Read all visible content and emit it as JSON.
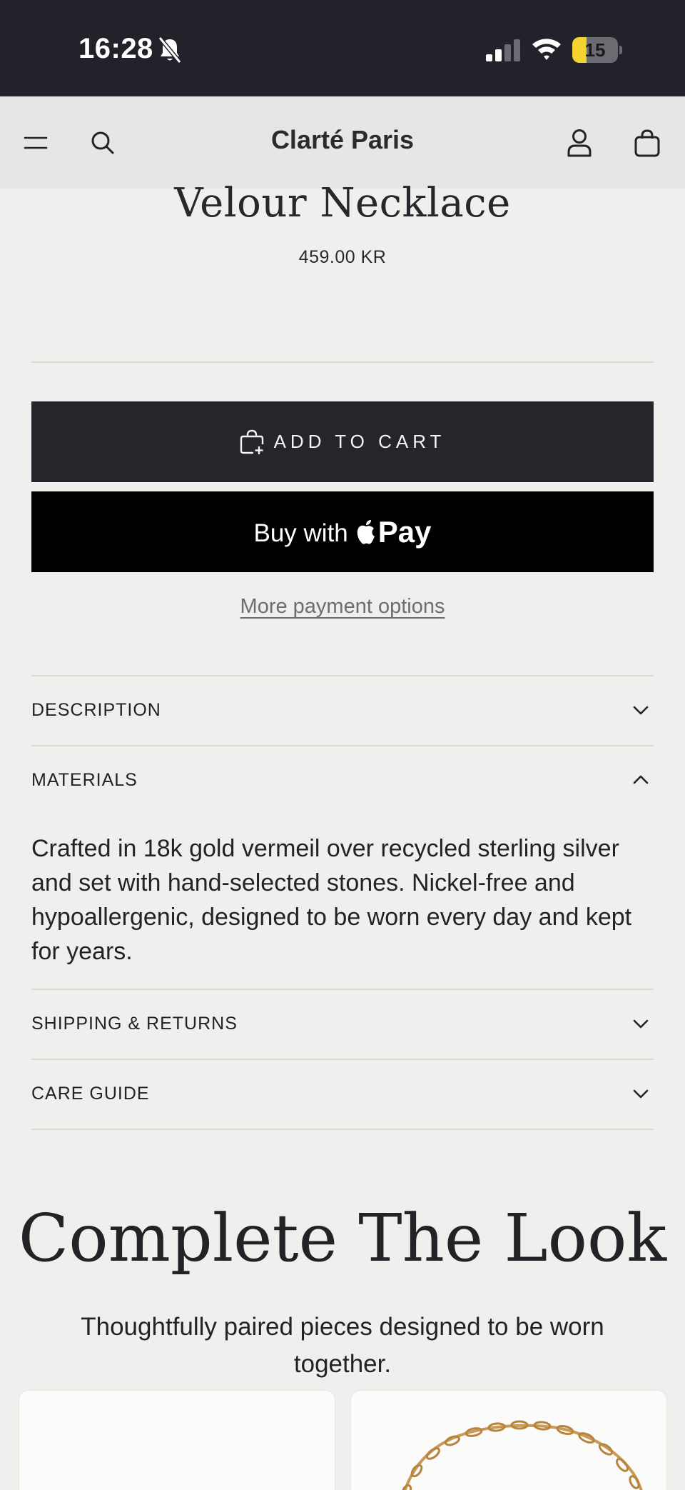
{
  "status_bar": {
    "time": "16:28",
    "battery": "15",
    "battery_level": 0.15
  },
  "header": {
    "brand": "Clarté Paris"
  },
  "product": {
    "title": "Velour Necklace",
    "price": "459.00 KR"
  },
  "actions": {
    "add_to_cart": "ADD TO CART",
    "buy_with": "Buy with",
    "pay": "Pay",
    "more_payment": "More payment options"
  },
  "accordion": {
    "description": "DESCRIPTION",
    "materials": "MATERIALS",
    "materials_body": "Crafted in 18k gold vermeil over recycled sterling silver and set with hand-selected stones. Nickel-free and hypoallergenic, designed to be worn every day and kept for years.",
    "shipping": "SHIPPING & RETURNS",
    "care": "CARE GUIDE"
  },
  "complete_look": {
    "title": "Complete The Look",
    "subtitle": "Thoughtfully paired pieces designed to be worn together."
  },
  "colors": {
    "background": "#f0efed",
    "header_bg": "#e6e6e4",
    "status_bar_bg": "#22232a",
    "primary_button": "#25262b",
    "apple_pay_button": "#000000",
    "battery_yellow": "#f4d22f",
    "chain_gold": "#c99a55"
  },
  "icons": {
    "status": [
      "bell-slash-icon",
      "signal-icon",
      "wifi-icon",
      "battery-icon"
    ],
    "header": [
      "menu-icon",
      "search-icon",
      "account-icon",
      "bag-icon"
    ],
    "add_to_cart": "bag-plus-icon",
    "apple": "apple-logo-icon",
    "chevrons": [
      "chevron-down-icon",
      "chevron-up-icon"
    ]
  }
}
